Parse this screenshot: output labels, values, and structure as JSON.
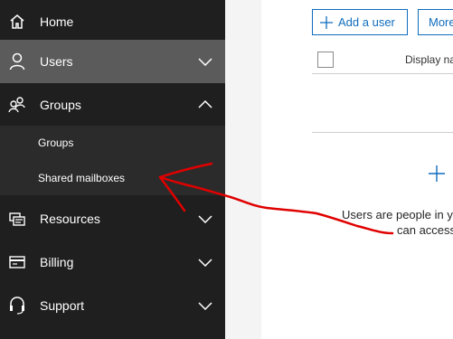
{
  "sidebar": {
    "items": [
      {
        "label": "Home",
        "icon": "home-icon"
      },
      {
        "label": "Users",
        "icon": "user-icon",
        "chevron": "chevron-down-icon",
        "state": "active"
      },
      {
        "label": "Groups",
        "icon": "groups-icon",
        "chevron": "chevron-up-icon",
        "state": "expanded"
      },
      {
        "label": "Resources",
        "icon": "resources-icon",
        "chevron": "chevron-down-icon"
      },
      {
        "label": "Billing",
        "icon": "billing-icon",
        "chevron": "chevron-down-icon"
      },
      {
        "label": "Support",
        "icon": "headset-icon",
        "chevron": "chevron-down-icon"
      }
    ],
    "groups_subitems": [
      {
        "label": "Groups"
      },
      {
        "label": "Shared mailboxes"
      }
    ]
  },
  "toolbar": {
    "add_user_label": "Add a user",
    "more_label": "More"
  },
  "table": {
    "column_header": "Display name"
  },
  "empty_state": {
    "line1": "Users are people in y",
    "line2": "can access"
  },
  "colors": {
    "sidebar_bg": "#1f1f1f",
    "active_item_bg": "#5b5b5b",
    "accent": "#0f6cbd",
    "annotation": "#e00000"
  }
}
